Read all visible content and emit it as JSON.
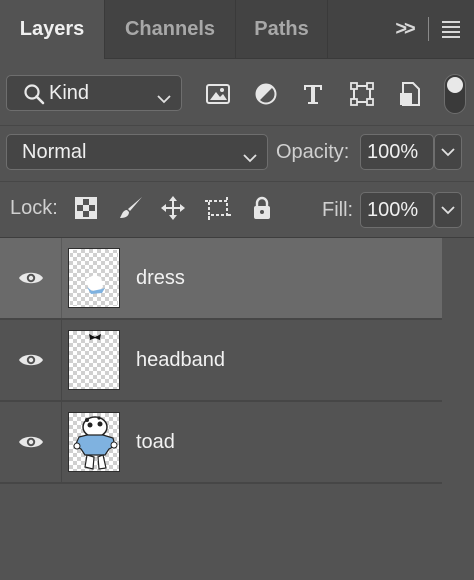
{
  "tabs": [
    {
      "label": "Layers",
      "active": true
    },
    {
      "label": "Channels",
      "active": false
    },
    {
      "label": "Paths",
      "active": false
    }
  ],
  "tab_more_label": ">>",
  "filter": {
    "kind_label": "Kind",
    "icons": [
      "image-filter-icon",
      "adjustment-filter-icon",
      "type-filter-icon",
      "shape-filter-icon",
      "smart-object-filter-icon"
    ],
    "toggle_on": true
  },
  "blend": {
    "mode": "Normal",
    "opacity_label": "Opacity:",
    "opacity_value": "100%"
  },
  "lock": {
    "label": "Lock:",
    "icons": [
      "lock-transparent-pixels-icon",
      "lock-image-pixels-icon",
      "lock-position-icon",
      "lock-artboard-icon",
      "lock-all-icon"
    ],
    "fill_label": "Fill:",
    "fill_value": "100%"
  },
  "layers": [
    {
      "name": "dress",
      "visible": true,
      "selected": true,
      "thumb": "dress-thumbnail"
    },
    {
      "name": "headband",
      "visible": true,
      "selected": false,
      "thumb": "headband-thumbnail"
    },
    {
      "name": "toad",
      "visible": true,
      "selected": false,
      "thumb": "toad-thumbnail"
    }
  ],
  "colors": {
    "panel_bg": "#535353",
    "selected_row": "#6a6a6a",
    "accent_blue": "#7fb2e0"
  }
}
